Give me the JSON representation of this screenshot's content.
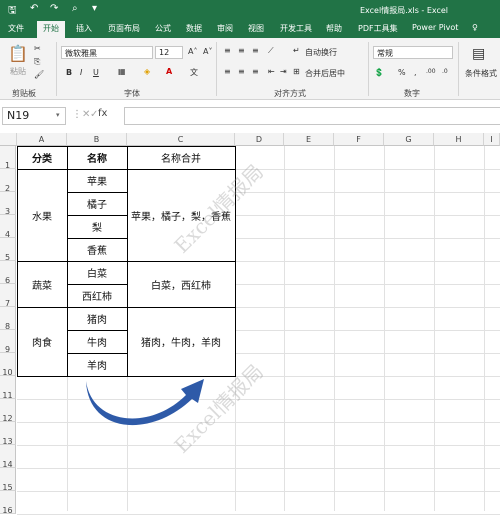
{
  "window": {
    "title": "Excel情报局.xls  -  Excel"
  },
  "tabs": [
    "文件",
    "开始",
    "插入",
    "页面布局",
    "公式",
    "数据",
    "审阅",
    "视图",
    "开发工具",
    "帮助",
    "PDF工具集",
    "Power Pivot"
  ],
  "ribbon": {
    "paste": "粘贴",
    "font_name": "微软雅黑",
    "font_size": "12",
    "bold": "B",
    "italic": "I",
    "underline": "U",
    "wrap": "自动换行",
    "merge": "合并后居中",
    "number_format": "常规",
    "percent": "%",
    "comma": ",",
    "cond_format": "条件格式",
    "groups": {
      "clipboard": "剪贴板",
      "font": "字体",
      "align": "对齐方式",
      "number": "数字"
    }
  },
  "formula_bar": {
    "name_box": "N19",
    "fx": "fx",
    "value": ""
  },
  "columns": [
    "A",
    "B",
    "C",
    "D",
    "E",
    "F",
    "G",
    "H",
    "I"
  ],
  "rows": [
    "1",
    "2",
    "3",
    "4",
    "5",
    "6",
    "7",
    "8",
    "9",
    "10",
    "11",
    "12",
    "13",
    "14",
    "15",
    "16"
  ],
  "table": {
    "headers": [
      "分类",
      "名称",
      "名称合并"
    ],
    "groups": [
      {
        "category": "水果",
        "items": [
          "苹果",
          "橘子",
          "梨",
          "香蕉"
        ],
        "merged": "苹果，橘子，梨，香蕉"
      },
      {
        "category": "蔬菜",
        "items": [
          "白菜",
          "西红柿"
        ],
        "merged": "白菜，西红柿"
      },
      {
        "category": "肉食",
        "items": [
          "猪肉",
          "牛肉",
          "羊肉"
        ],
        "merged": "猪肉，牛肉，羊肉"
      }
    ]
  },
  "watermark": "Excel情报局",
  "colors": {
    "accent": "#217346",
    "arrow": "#2e5aa8"
  }
}
